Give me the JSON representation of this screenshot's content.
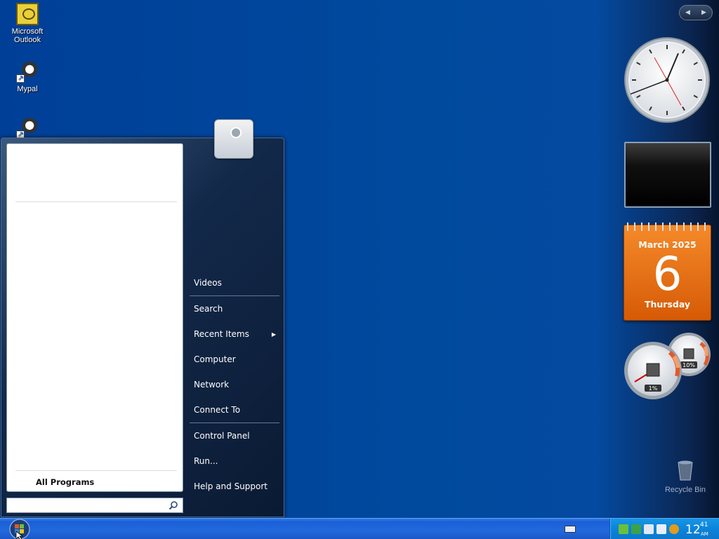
{
  "desktop": {
    "icons": [
      {
        "label_line1": "Microsoft",
        "label_line2": "Outlook",
        "icon": "outlook-icon"
      },
      {
        "label_line1": "Mypal",
        "label_line2": "",
        "icon": "mypal-icon"
      },
      {
        "label_line1": "",
        "label_line2": "",
        "icon": "mypal-shortcut-icon"
      }
    ],
    "recycle_bin": {
      "label": "Recycle Bin",
      "icon": "recycle-bin-icon"
    }
  },
  "gadgets": {
    "calendar": {
      "month_year": "March 2025",
      "day": "6",
      "weekday": "Thursday"
    },
    "meter": {
      "cpu": "1%",
      "memory": "10%"
    }
  },
  "start_menu": {
    "all_programs": "All Programs",
    "search_placeholder": "",
    "right_items": [
      {
        "label": "Videos"
      },
      {
        "label": "Search"
      },
      {
        "label": "Recent Items"
      },
      {
        "label": "Computer"
      },
      {
        "label": "Network"
      },
      {
        "label": "Connect To"
      },
      {
        "label": "Control Panel"
      },
      {
        "label": "Run..."
      },
      {
        "label": "Help and Support"
      }
    ]
  },
  "taskbar": {
    "clock": {
      "hour": "12",
      "minute": "41",
      "ampm": "AM"
    }
  },
  "colors": {
    "desktop": "#004a9e",
    "taskbar": "#2169dd",
    "tray": "#0c83d9",
    "calendar": "#e8711a"
  }
}
